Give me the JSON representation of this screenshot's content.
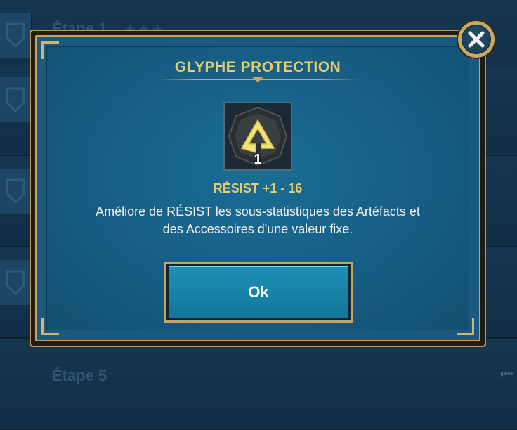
{
  "background": {
    "stage_top_label": "Étape 1",
    "stage_bottom_label": "Étape 5",
    "stars": "★★★",
    "watermark": "game"
  },
  "dialog": {
    "title": "GLYPHE PROTECTION",
    "glyph": {
      "icon": "glyph-resist-icon",
      "count": "1"
    },
    "stat": "RÉSIST +1 - 16",
    "description_line1": "Améliore de RÉSIST les sous-statistiques des Artéfacts et",
    "description_line2": "des Accessoires d'une valeur fixe.",
    "ok_label": "Ok",
    "close_icon": "close-icon"
  },
  "colors": {
    "gold": "#e8cc6a",
    "frame_gold": "#c7a466",
    "panel_blue": "#175e84",
    "button_blue": "#1783a8"
  }
}
